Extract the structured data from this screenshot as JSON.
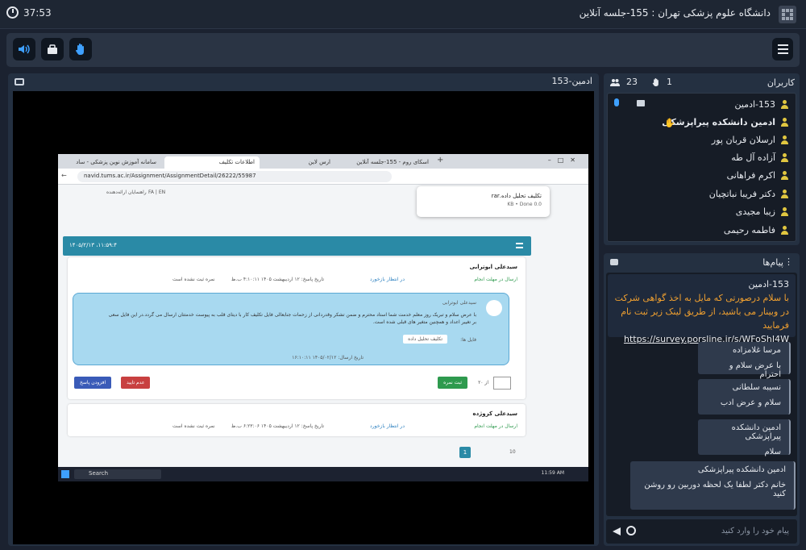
{
  "app": {
    "title": "دانشگاه علوم پزشکی تهران : 155-جلسه آنلاین",
    "timer": "37:53"
  },
  "toolbar": {
    "buttons": [
      {
        "name": "speaker-button",
        "icon": "speaker-icon"
      },
      {
        "name": "briefcase-button",
        "icon": "briefcase-icon"
      },
      {
        "name": "raise-hand-button",
        "icon": "hand-icon"
      }
    ]
  },
  "stage": {
    "presenter": "153-ادمین"
  },
  "shared_screen": {
    "tabs": [
      "سامانه آموزش نوین پزشکی - ساد",
      "اطلاعات تکلیف",
      "ارس لاین",
      "اسکای روم - 155-جلسه آنلاین"
    ],
    "url": "navid.tums.ac.ir/Assignment/AssignmentDetail/26222/55987",
    "download": {
      "file": "تکلیف تحلیل داده.rar",
      "status": "0.0 KB • Done"
    },
    "portal_datetime": "۱۴۰۵/۲/۱۳ ،۱۱:۵۹:۴",
    "user_menu": "راهنمایان ارائه‌دهنده",
    "lang": "FA | EN",
    "submissions": [
      {
        "student": "سیدعلی ابوترابی",
        "status": "ارسال در مهلت انجام",
        "review": "در انتظار بازخورد",
        "date": "تاریخ پاسخ: ۱۲ اردیبهشت ۱۴۰۵ ۴:۱۰:۱۱ ب.ظ",
        "grade": "نمره ثبت نشده است"
      },
      {
        "student": "سیدعلی کروژده",
        "status": "ارسال در مهلت انجام",
        "review": "در انتظار بازخورد",
        "date": "تاریخ پاسخ: ۱۲ اردیبهشت ۱۴۰۵ ۶:۲۳:۰۶ ب.ظ",
        "grade": "نمره ثبت نشده است"
      }
    ],
    "bubble": {
      "author": "سیدعلی ابوترابی",
      "text": "با عرض سلام و تبریک روز معلم خدمت شما استاد محترم و ضمن تشکر وقدردانی از زحمات جنابعالی فایل تکلیف کار با دیتای قلب به پیوست خدمتتان ارسال می گردد.در این فایل سعی بر تغییر اعداد و همچنین متغیر های قبلی شده است.",
      "attach_label": "فایل ها:",
      "attach_file": "تکلیف تحلیل داده",
      "sent": "تاریخ ارسال: ۱۴۰۵/۰۲/۱۲ ۱۶:۱۰:۱۱"
    },
    "actions": {
      "grade_of": "از ۲۰",
      "grade_value": "",
      "submit_grade": "ثبت نمره",
      "reject": "عدم تایید",
      "add_reply": "افزودن پاسخ"
    },
    "pagination": {
      "page": "1",
      "size": "10"
    },
    "taskbar": {
      "search": "Search",
      "time": "11:59 AM"
    }
  },
  "users": {
    "title": "کاربران",
    "raised_hands": "1",
    "count": "23",
    "list": [
      {
        "name": "153-ادمین",
        "bold": false
      },
      {
        "name": "ادمین دانشکده پیراپزشکی",
        "bold": true
      },
      {
        "name": "ارسلان قربان پور",
        "bold": false
      },
      {
        "name": "آزاده آل طه",
        "bold": false
      },
      {
        "name": "اکرم فراهانی",
        "bold": false
      },
      {
        "name": "دکتر فریبا نباتچیان",
        "bold": false
      },
      {
        "name": "زیبا مجیدی",
        "bold": false
      },
      {
        "name": "فاطمه رحیمی",
        "bold": false
      }
    ]
  },
  "chat": {
    "title": "پیام‌ها",
    "pinned": {
      "author": "153-ادمین",
      "text": "با سلام درصورتی که مایل به اخذ گواهی شرکت در وبینار می باشید، از طریق لینک زیر ثبت نام فرمایید",
      "link": "https://survey.porsline.ir/s/WFoShJ4W"
    },
    "messages": [
      {
        "author": "مرسا غلامزاده",
        "text": "با عرض سلام و احترام"
      },
      {
        "author": "نسیبه سلطانی",
        "text": "سلام و عرض ادب"
      },
      {
        "author": "ادمین دانشکده پیراپزشکی",
        "text": "سلام"
      },
      {
        "author": "ادمین دانشکده پیراپزشکی",
        "text": "خانم دکتر لطفا یک لحظه دوربین رو روشن کنید"
      }
    ],
    "input_placeholder": "پیام خود را وارد کنید"
  }
}
